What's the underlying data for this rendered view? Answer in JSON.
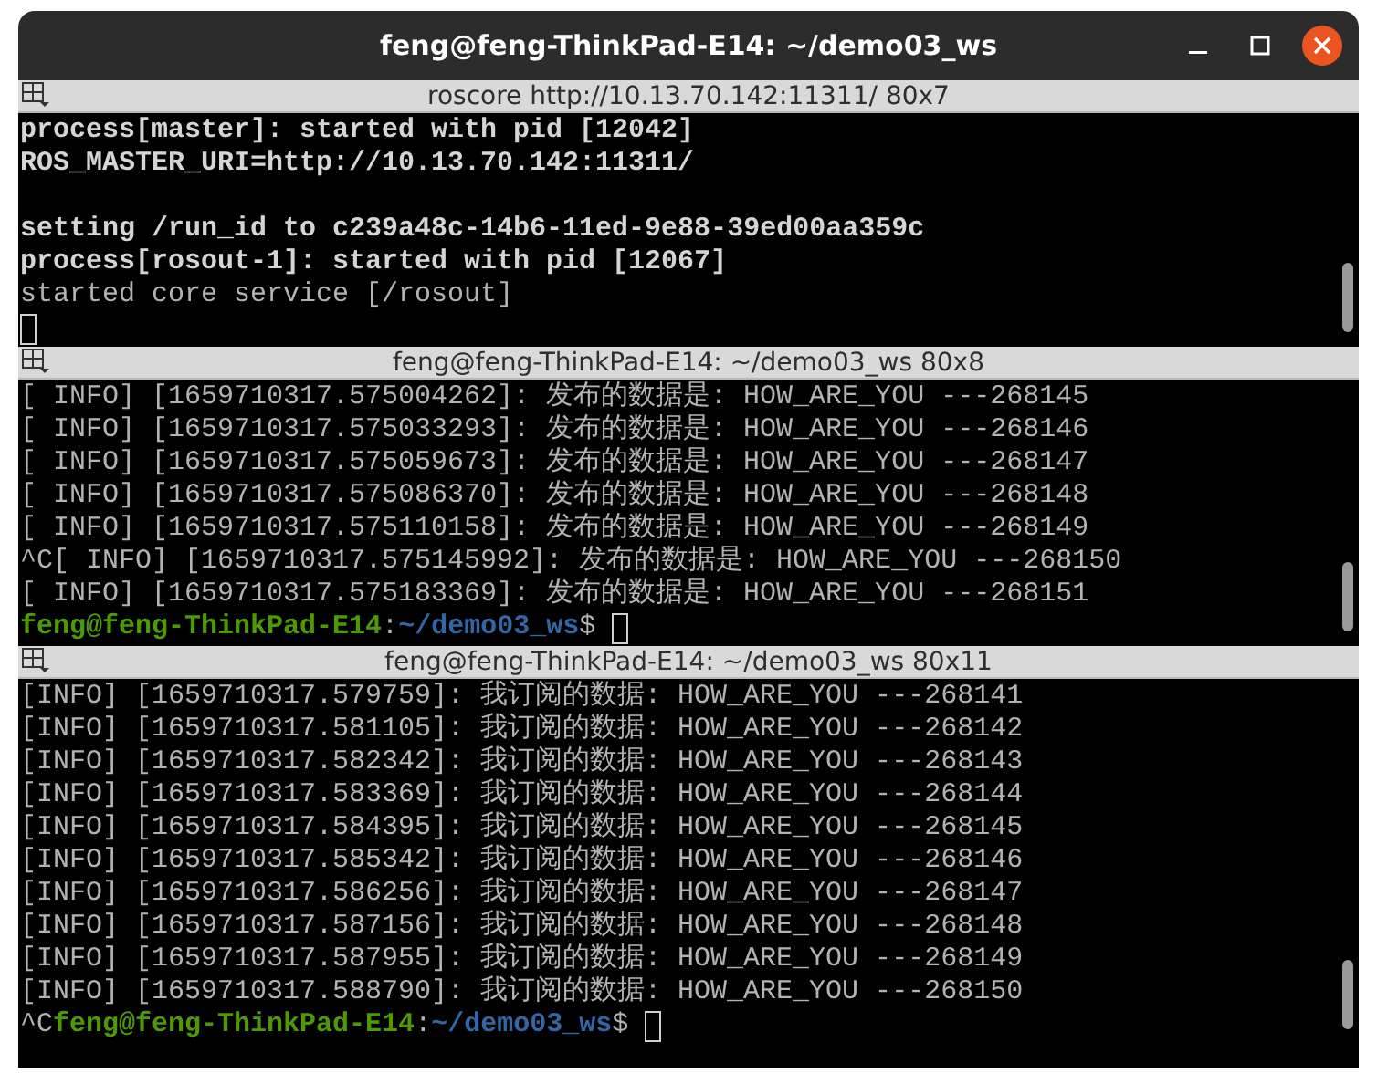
{
  "window": {
    "title": "feng@feng-ThinkPad-E14: ~/demo03_ws"
  },
  "panes": [
    {
      "title": "roscore http://10.13.70.142:11311/ 80x7",
      "lines": [
        {
          "segments": [
            {
              "kind": "bold",
              "text": "process[master]: started with pid [12042]"
            }
          ]
        },
        {
          "segments": [
            {
              "kind": "bold",
              "text": "ROS_MASTER_URI=http://10.13.70.142:11311/"
            }
          ]
        },
        {
          "blank": true
        },
        {
          "segments": [
            {
              "kind": "bold",
              "text": "setting /run_id to c239a48c-14b6-11ed-9e88-39ed00aa359c"
            }
          ]
        },
        {
          "segments": [
            {
              "kind": "bold",
              "text": "process[rosout-1]: started with pid [12067]"
            }
          ]
        },
        {
          "segments": [
            {
              "kind": "normal",
              "text": "started core service [/rosout]"
            }
          ]
        },
        {
          "cursor": true
        }
      ]
    },
    {
      "title": "feng@feng-ThinkPad-E14: ~/demo03_ws 80x8",
      "lines": [
        {
          "segments": [
            {
              "kind": "normal",
              "text": "[ INFO] [1659710317.575004262]: 发布的数据是: HOW_ARE_YOU ---268145"
            }
          ]
        },
        {
          "segments": [
            {
              "kind": "normal",
              "text": "[ INFO] [1659710317.575033293]: 发布的数据是: HOW_ARE_YOU ---268146"
            }
          ]
        },
        {
          "segments": [
            {
              "kind": "normal",
              "text": "[ INFO] [1659710317.575059673]: 发布的数据是: HOW_ARE_YOU ---268147"
            }
          ]
        },
        {
          "segments": [
            {
              "kind": "normal",
              "text": "[ INFO] [1659710317.575086370]: 发布的数据是: HOW_ARE_YOU ---268148"
            }
          ]
        },
        {
          "segments": [
            {
              "kind": "normal",
              "text": "[ INFO] [1659710317.575110158]: 发布的数据是: HOW_ARE_YOU ---268149"
            }
          ]
        },
        {
          "segments": [
            {
              "kind": "normal",
              "text": "^C[ INFO] [1659710317.575145992]: 发布的数据是: HOW_ARE_YOU ---268150"
            }
          ]
        },
        {
          "segments": [
            {
              "kind": "normal",
              "text": "[ INFO] [1659710317.575183369]: 发布的数据是: HOW_ARE_YOU ---268151"
            }
          ]
        },
        {
          "segments": [
            {
              "kind": "user",
              "text": "feng@feng-ThinkPad-E14"
            },
            {
              "kind": "normal",
              "text": ":"
            },
            {
              "kind": "path",
              "text": "~/demo03_ws"
            },
            {
              "kind": "normal",
              "text": "$"
            }
          ],
          "cursor": true
        }
      ]
    },
    {
      "title": "feng@feng-ThinkPad-E14: ~/demo03_ws 80x11",
      "lines": [
        {
          "segments": [
            {
              "kind": "normal",
              "text": "[INFO] [1659710317.579759]: 我订阅的数据: HOW_ARE_YOU ---268141"
            }
          ]
        },
        {
          "segments": [
            {
              "kind": "normal",
              "text": "[INFO] [1659710317.581105]: 我订阅的数据: HOW_ARE_YOU ---268142"
            }
          ]
        },
        {
          "segments": [
            {
              "kind": "normal",
              "text": "[INFO] [1659710317.582342]: 我订阅的数据: HOW_ARE_YOU ---268143"
            }
          ]
        },
        {
          "segments": [
            {
              "kind": "normal",
              "text": "[INFO] [1659710317.583369]: 我订阅的数据: HOW_ARE_YOU ---268144"
            }
          ]
        },
        {
          "segments": [
            {
              "kind": "normal",
              "text": "[INFO] [1659710317.584395]: 我订阅的数据: HOW_ARE_YOU ---268145"
            }
          ]
        },
        {
          "segments": [
            {
              "kind": "normal",
              "text": "[INFO] [1659710317.585342]: 我订阅的数据: HOW_ARE_YOU ---268146"
            }
          ]
        },
        {
          "segments": [
            {
              "kind": "normal",
              "text": "[INFO] [1659710317.586256]: 我订阅的数据: HOW_ARE_YOU ---268147"
            }
          ]
        },
        {
          "segments": [
            {
              "kind": "normal",
              "text": "[INFO] [1659710317.587156]: 我订阅的数据: HOW_ARE_YOU ---268148"
            }
          ]
        },
        {
          "segments": [
            {
              "kind": "normal",
              "text": "[INFO] [1659710317.587955]: 我订阅的数据: HOW_ARE_YOU ---268149"
            }
          ]
        },
        {
          "segments": [
            {
              "kind": "normal",
              "text": "[INFO] [1659710317.588790]: 我订阅的数据: HOW_ARE_YOU ---268150"
            }
          ]
        },
        {
          "segments": [
            {
              "kind": "normal",
              "text": "^C"
            },
            {
              "kind": "user",
              "text": "feng@feng-ThinkPad-E14"
            },
            {
              "kind": "normal",
              "text": ":"
            },
            {
              "kind": "path",
              "text": "~/demo03_ws"
            },
            {
              "kind": "normal",
              "text": "$"
            }
          ],
          "cursor": true
        }
      ]
    }
  ]
}
